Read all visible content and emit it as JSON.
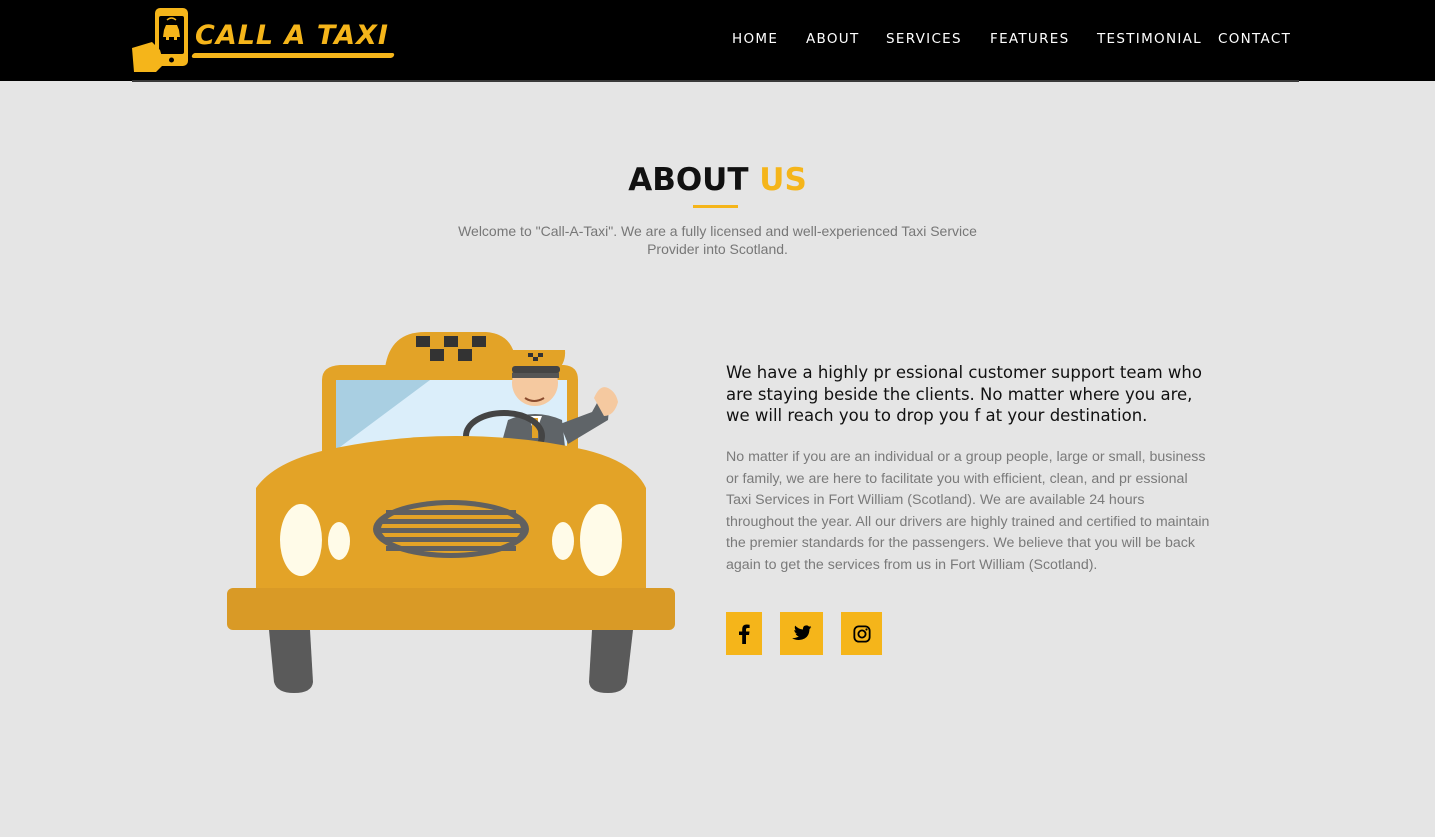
{
  "brand": {
    "logo_text": "CALL A TAXI",
    "accent_color": "#f5b51a",
    "icons": [
      "phone-in-hand-icon",
      "taxi-icon"
    ]
  },
  "nav": {
    "items": [
      {
        "label": "HOME"
      },
      {
        "label": "ABOUT"
      },
      {
        "label": "SERVICES"
      },
      {
        "label": "FEATURES"
      },
      {
        "label": "TESTIMONIAL"
      },
      {
        "label": "CONTACT"
      }
    ]
  },
  "about": {
    "heading_part1": "ABOUT",
    "heading_part2": "US",
    "intro": "Welcome to \"Call-A-Taxi\". We are a fully licensed and well-experienced Taxi Service Provider into Scotland.",
    "lead": "We have a highly pr essional customer support team who are staying beside the clients. No matter where you are, we will reach you to drop you f at your destination.",
    "body": "No matter if you are an individual or a group people, large or small, business or family, we are here to facilitate you with efficient, clean, and pr essional Taxi Services in Fort William (Scotland). We are available 24 hours throughout the year. All our drivers are highly trained and certified to maintain the premier standards for the passengers. We believe that you will be back again to get the services from us in Fort William (Scotland)."
  },
  "social": {
    "items": [
      {
        "icon": "facebook-icon"
      },
      {
        "icon": "twitter-icon"
      },
      {
        "icon": "instagram-icon"
      }
    ]
  },
  "colors": {
    "header_bg": "#000000",
    "page_bg": "#e5e5e5",
    "accent": "#f5b51a",
    "taxi_body": "#e3a327"
  }
}
